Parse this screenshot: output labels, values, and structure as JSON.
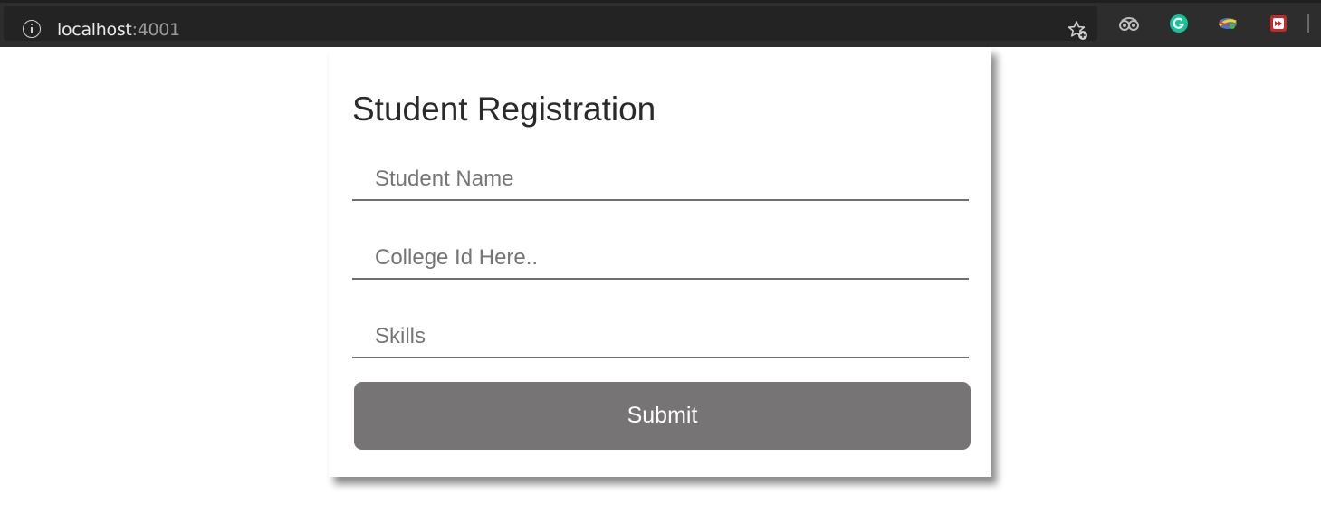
{
  "browser": {
    "url_host": "localhost",
    "url_port": ":4001",
    "icons": [
      "info-icon",
      "bookmark-star-icon",
      "extension-icon",
      "grammarly-icon",
      "extension-globe-icon",
      "extension-red-icon"
    ]
  },
  "form": {
    "title": "Student Registration",
    "fields": [
      {
        "placeholder": "Student Name",
        "value": ""
      },
      {
        "placeholder": "College Id Here..",
        "value": ""
      },
      {
        "placeholder": "Skills",
        "value": ""
      }
    ],
    "submit_label": "Submit"
  },
  "colors": {
    "button_bg": "#767475",
    "browser_bar": "#2d2d2d"
  }
}
